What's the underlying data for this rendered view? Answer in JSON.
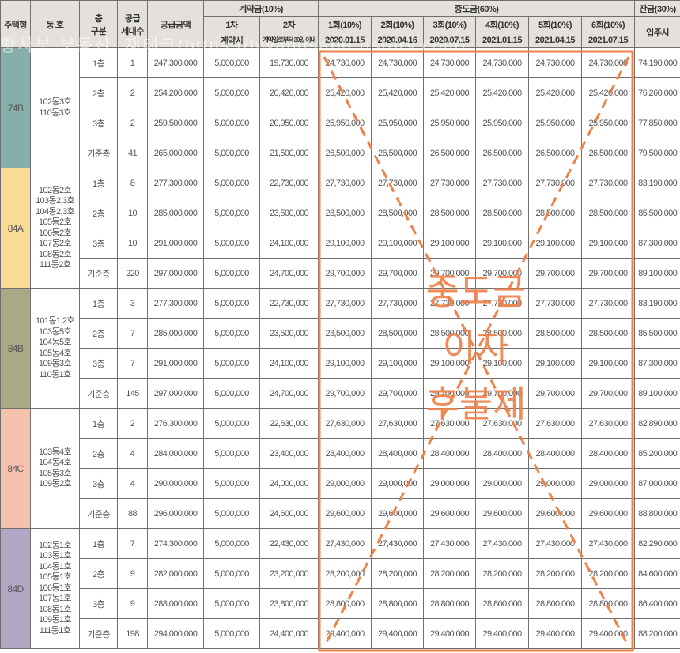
{
  "header": {
    "type": "주택형",
    "dong": "동,호",
    "floor": "층\n구분",
    "floor_l1": "층",
    "floor_l2": "구분",
    "units_l1": "공급",
    "units_l2": "세대수",
    "price": "공급금액",
    "deposit": "계약금(10%)",
    "deposit_1": "1차",
    "deposit_1_when": "계약시",
    "deposit_2": "2차",
    "deposit_2_when": "계약일로부터 30일 이내",
    "middle": "중도금(60%)",
    "middle_installments": [
      {
        "label": "1회(10%)",
        "date": "2020.01.15"
      },
      {
        "label": "2회(10%)",
        "date": "2020.04.16"
      },
      {
        "label": "3회(10%)",
        "date": "2020.07.15"
      },
      {
        "label": "4회(10%)",
        "date": "2021.01.15"
      },
      {
        "label": "5회(10%)",
        "date": "2021.04.15"
      },
      {
        "label": "6회(10%)",
        "date": "2021.07.15"
      }
    ],
    "balance": "잔금(30%)",
    "balance_when": "입주시"
  },
  "overlay": {
    "stamp_lines": [
      "중도금",
      "이자",
      "후불제"
    ],
    "color": "#ee8048"
  },
  "watermark": "황사부 부동산, 재테크(https://hwangsabu.tistory.com)",
  "groups": [
    {
      "type": "74B",
      "color": "#86aeaa",
      "dong": "102동3호\n110동3호",
      "rows": [
        {
          "floor": "1층",
          "units": "1",
          "price": "247,300,000",
          "d1": "5,000,000",
          "d2": "19,730,000",
          "mid": "24,730,000",
          "bal": "74,190,000"
        },
        {
          "floor": "2층",
          "units": "2",
          "price": "254,200,000",
          "d1": "5,000,000",
          "d2": "20,420,000",
          "mid": "25,420,000",
          "bal": "76,260,000"
        },
        {
          "floor": "3층",
          "units": "2",
          "price": "259,500,000",
          "d1": "5,000,000",
          "d2": "20,950,000",
          "mid": "25,950,000",
          "bal": "77,850,000"
        },
        {
          "floor": "기준층",
          "units": "41",
          "price": "265,000,000",
          "d1": "5,000,000",
          "d2": "21,500,000",
          "mid": "26,500,000",
          "bal": "79,500,000"
        }
      ]
    },
    {
      "type": "84A",
      "color": "#f8dc95",
      "dong": "102동2호\n103동2,3호\n104동2,3호\n105동2호\n106동2호\n107동2호\n108동2호\n111동2호",
      "rows": [
        {
          "floor": "1층",
          "units": "8",
          "price": "277,300,000",
          "d1": "5,000,000",
          "d2": "22,730,000",
          "mid": "27,730,000",
          "bal": "83,190,000"
        },
        {
          "floor": "2층",
          "units": "10",
          "price": "285,000,000",
          "d1": "5,000,000",
          "d2": "23,500,000",
          "mid": "28,500,000",
          "bal": "85,500,000"
        },
        {
          "floor": "3층",
          "units": "10",
          "price": "291,000,000",
          "d1": "5,000,000",
          "d2": "24,100,000",
          "mid": "29,100,000",
          "bal": "87,300,000"
        },
        {
          "floor": "기준층",
          "units": "220",
          "price": "297,000,000",
          "d1": "5,000,000",
          "d2": "24,700,000",
          "mid": "29,700,000",
          "bal": "89,100,000"
        }
      ]
    },
    {
      "type": "84B",
      "color": "#aba887",
      "dong": "101동1,2호\n103동5호\n104동5호\n105동4호\n109동3호\n110동1호",
      "rows": [
        {
          "floor": "1층",
          "units": "3",
          "price": "277,300,000",
          "d1": "5,000,000",
          "d2": "22,730,000",
          "mid": "27,730,000",
          "bal": "83,190,000"
        },
        {
          "floor": "2층",
          "units": "7",
          "price": "285,000,000",
          "d1": "5,000,000",
          "d2": "23,500,000",
          "mid": "28,500,000",
          "bal": "85,500,000"
        },
        {
          "floor": "3층",
          "units": "7",
          "price": "291,000,000",
          "d1": "5,000,000",
          "d2": "24,100,000",
          "mid": "29,100,000",
          "bal": "87,300,000"
        },
        {
          "floor": "기준층",
          "units": "145",
          "price": "297,000,000",
          "d1": "5,000,000",
          "d2": "24,700,000",
          "mid": "29,700,000",
          "bal": "89,100,000"
        }
      ]
    },
    {
      "type": "84C",
      "color": "#f6c2ad",
      "dong": "103동4호\n104동4호\n105동3호\n109동2호",
      "rows": [
        {
          "floor": "1층",
          "units": "2",
          "price": "276,300,000",
          "d1": "5,000,000",
          "d2": "22,630,000",
          "mid": "27,630,000",
          "bal": "82,890,000"
        },
        {
          "floor": "2층",
          "units": "4",
          "price": "284,000,000",
          "d1": "5,000,000",
          "d2": "23,400,000",
          "mid": "28,400,000",
          "bal": "85,200,000"
        },
        {
          "floor": "3층",
          "units": "4",
          "price": "290,000,000",
          "d1": "5,000,000",
          "d2": "24,000,000",
          "mid": "29,000,000",
          "bal": "87,000,000"
        },
        {
          "floor": "기준층",
          "units": "88",
          "price": "296,000,000",
          "d1": "5,000,000",
          "d2": "24,600,000",
          "mid": "29,600,000",
          "bal": "88,800,000"
        }
      ]
    },
    {
      "type": "84D",
      "color": "#b2a8c6",
      "dong": "102동1호\n103동1호\n104동1호\n105동1호\n106동1호\n107동1호\n108동1호\n109동1호\n111동1호",
      "rows": [
        {
          "floor": "1층",
          "units": "7",
          "price": "274,300,000",
          "d1": "5,000,000",
          "d2": "22,430,000",
          "mid": "27,430,000",
          "bal": "82,290,000"
        },
        {
          "floor": "2층",
          "units": "9",
          "price": "282,000,000",
          "d1": "5,000,000",
          "d2": "23,200,000",
          "mid": "28,200,000",
          "bal": "84,600,000"
        },
        {
          "floor": "3층",
          "units": "9",
          "price": "288,000,000",
          "d1": "5,000,000",
          "d2": "23,800,000",
          "mid": "28,800,000",
          "bal": "86,400,000"
        },
        {
          "floor": "기준층",
          "units": "198",
          "price": "294,000,000",
          "d1": "5,000,000",
          "d2": "24,400,000",
          "mid": "29,400,000",
          "bal": "88,200,000"
        }
      ]
    }
  ]
}
